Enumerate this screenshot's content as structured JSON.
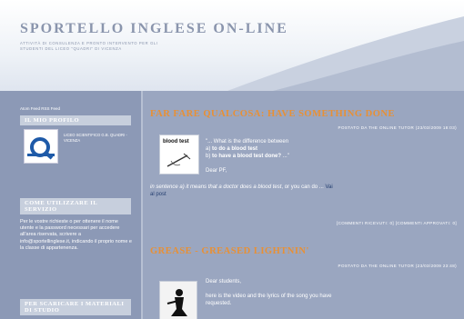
{
  "header": {
    "title": "SPORTELLO INGLESE ON-LINE",
    "subtitle": "ATTIVITÀ DI CONSULENZA E PRONTO INTERVENTO PER GLI STUDENTI DEL LICEO \"QUADRI\" DI VICENZA"
  },
  "sidebar": {
    "feeds": "Atom Feed  RSS Feed",
    "profile": {
      "heading": "IL MIO PROFILO",
      "name": "LICEO SCIENTIFICO G.B. QUADRI - VICENZA"
    },
    "use": {
      "heading": "COME UTILIZZARE IL SERVIZIO",
      "text": "Per le vostre richieste o per ottenere il nome utente e la password necessari per accedere all'area riservata, scrivere a info@sportellinglese.it, indicando il proprio nome e la classe di appartenenza."
    },
    "download_heading": "PER SCARICARE I MATERIALI DI STUDIO"
  },
  "posts": [
    {
      "title": "FAR FARE QUALCOSA: HAVE SOMETHING DONE",
      "meta": "POSTATO DA THE ONLINE TUTOR (23/03/2009 18:03)",
      "thumb_label": "blood test",
      "line1": "\"... What is the difference between",
      "line2a": "a) ",
      "line2b": "to do a blood test",
      "line3a": "b) ",
      "line3b": "to have a blood test done?",
      "line3c": " ...\"",
      "line4": "Dear PF,",
      "line5a": "in sentence a) it means that a doctor does a blood test",
      "line5b": ", or you can do ... ",
      "line5link": "Vai",
      "line6": "al post",
      "comments": "[COMMENTI RICEVUTI: 0]   [COMMENTI APPROVATI: 0]"
    },
    {
      "title": "GREASE - GREASED LIGHTNIN'",
      "meta": "POSTATO DA THE ONLINE TUTOR (23/03/2009 23:48)",
      "line1": "Dear students,",
      "line2": "here is the video and the lyrics of the song you have",
      "line3": "requested."
    }
  ]
}
